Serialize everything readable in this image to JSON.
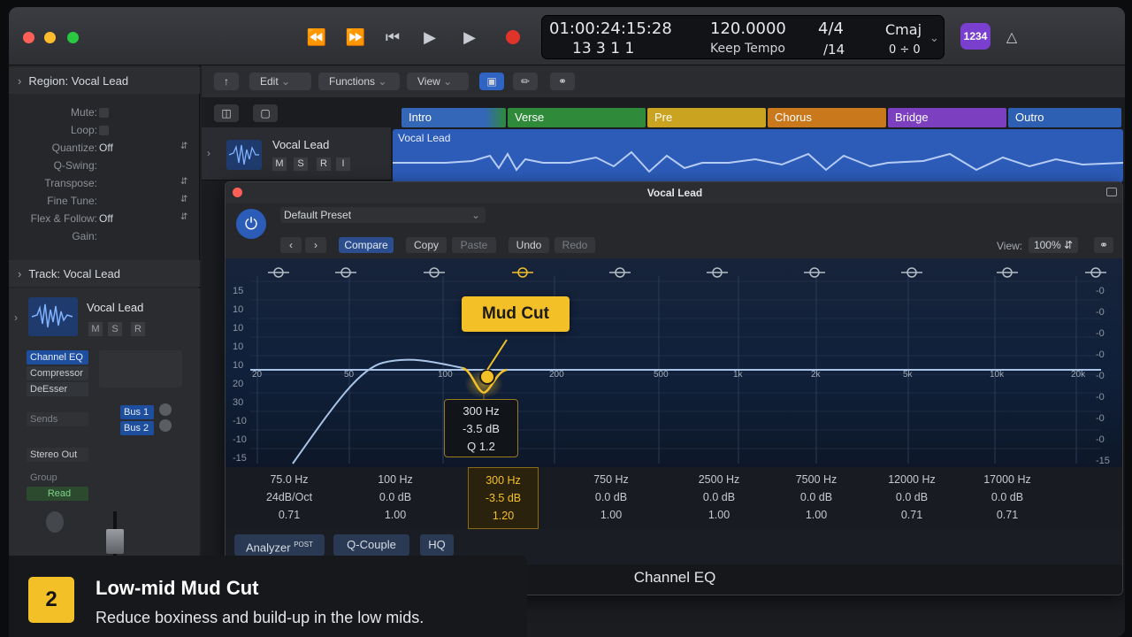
{
  "transport": {
    "position": "01:00:24:15:28",
    "bars": "13  3  1      1",
    "tempo": "120.0000",
    "tempo_mode": "Keep Tempo",
    "signature": "4/4",
    "division": "/14",
    "key": "Cmaj",
    "key_sub": "0 ÷ 0",
    "badge": "1234"
  },
  "region": {
    "header": "Region: Vocal Lead",
    "params": [
      {
        "label": "Mute:",
        "value": ""
      },
      {
        "label": "Loop:",
        "value": ""
      },
      {
        "label": "Quantize:",
        "value": "Off"
      },
      {
        "label": "Q-Swing:",
        "value": ""
      },
      {
        "label": "Transpose:",
        "value": ""
      },
      {
        "label": "Fine Tune:",
        "value": ""
      },
      {
        "label": "Flex & Follow:",
        "value": "Off"
      },
      {
        "label": "Gain:",
        "value": ""
      }
    ]
  },
  "track": {
    "header": "Track: Vocal Lead",
    "name": "Vocal Lead",
    "m": "M",
    "s": "S",
    "r": "R",
    "i": "I",
    "plugins": [
      "Channel EQ",
      "Compressor",
      "DeEsser"
    ],
    "sends": "Sends",
    "bus1": "Bus 1",
    "bus2": "Bus 2",
    "output": "Stereo Out",
    "group": "Group",
    "automation": "Read"
  },
  "main_toolbar": {
    "edit": "Edit",
    "functions": "Functions",
    "view": "View"
  },
  "markers": [
    {
      "label": "Intro",
      "color": "#3567b8"
    },
    {
      "label": "Verse",
      "color": "#2f8a3a"
    },
    {
      "label": "Pre",
      "color": "#caa320"
    },
    {
      "label": "Chorus",
      "color": "#c9781c"
    },
    {
      "label": "Bridge",
      "color": "#7c3fc0"
    },
    {
      "label": "Outro",
      "color": "#2d5fb3"
    }
  ],
  "track_lane": {
    "name": "Vocal Lead",
    "region_name": "Vocal Lead"
  },
  "plugin": {
    "title": "Vocal Lead",
    "preset": "Default Preset",
    "compare": "Compare",
    "copy": "Copy",
    "paste": "Paste",
    "undo": "Undo",
    "redo": "Redo",
    "view_label": "View:",
    "view_value": "100%",
    "db_left": [
      "15",
      "10",
      "10",
      "10",
      "10",
      "20",
      "30",
      "-10",
      "-10",
      "-15"
    ],
    "db_right": [
      "-0",
      "-0",
      "-0",
      "-0",
      "-0",
      "-0",
      "-0",
      "-0",
      "-15"
    ],
    "freq_ticks": [
      "20",
      "50",
      "100",
      "200",
      "500",
      "1k",
      "2k",
      "5k",
      "10k",
      "20k"
    ],
    "bands": [
      {
        "freq": "75.0 Hz",
        "gain": "24dB/Oct",
        "q": "0.71"
      },
      {
        "freq": "100 Hz",
        "gain": "0.0 dB",
        "q": "1.00"
      },
      {
        "freq": "300 Hz",
        "gain": "-3.5 dB",
        "q": "1.20"
      },
      {
        "freq": "750 Hz",
        "gain": "0.0 dB",
        "q": "1.00"
      },
      {
        "freq": "2500 Hz",
        "gain": "0.0 dB",
        "q": "1.00"
      },
      {
        "freq": "7500 Hz",
        "gain": "0.0 dB",
        "q": "1.00"
      },
      {
        "freq": "12000 Hz",
        "gain": "0.0 dB",
        "q": "0.71"
      },
      {
        "freq": "17000 Hz",
        "gain": "0.0 dB",
        "q": "0.71"
      }
    ],
    "analyzer": "Analyzer",
    "analyzer_tag": "POST",
    "q_couple": "Q-Couple",
    "hq": "HQ",
    "footer": "Channel EQ"
  },
  "callout": {
    "label": "Mud Cut"
  },
  "tooltip": {
    "freq": "300 Hz",
    "gain": "-3.5 dB",
    "q": "Q 1.2"
  },
  "caption": {
    "step": "2",
    "title": "Low-mid Mud Cut",
    "subtitle": "Reduce boxiness and build-up in the low mids."
  },
  "accent": "#f4c028"
}
